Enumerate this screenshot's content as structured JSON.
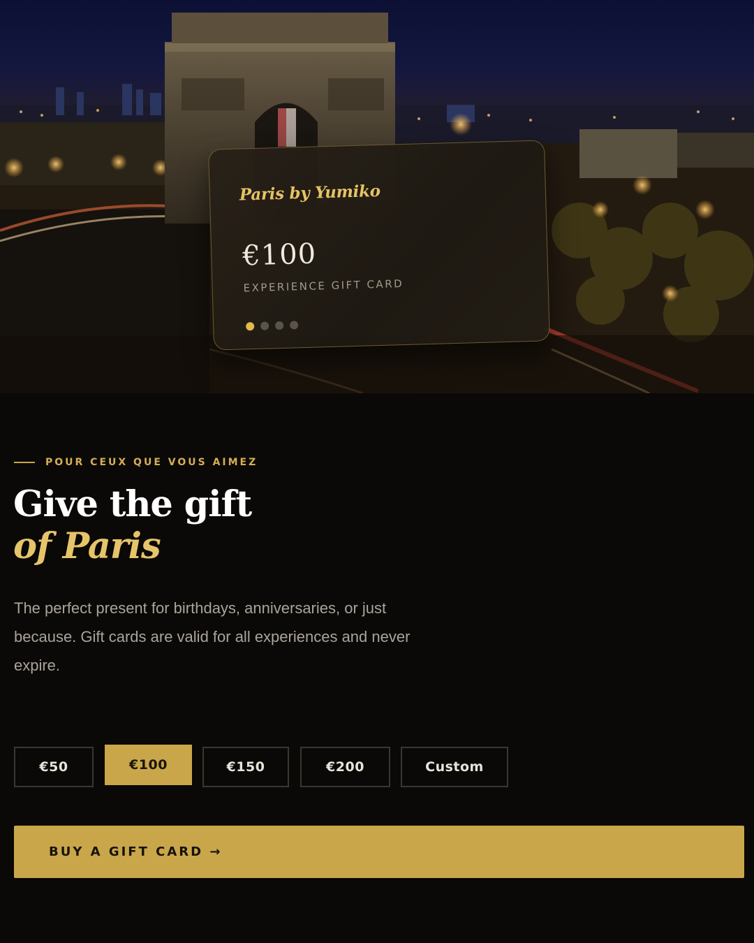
{
  "hero": {
    "card": {
      "brand": "Paris by Yumiko",
      "value": "€100",
      "type": "EXPERIENCE GIFT CARD",
      "carousel": {
        "total": 4,
        "active": 1
      }
    }
  },
  "section": {
    "eyebrow": "POUR CEUX QUE VOUS AIMEZ",
    "headline_line1": "Give the gift",
    "headline_line2": "of Paris",
    "description": "The perfect present for birthdays, anniversaries, or just because. Gift cards are valid for all experiences and never expire."
  },
  "amounts": {
    "options": [
      "€50",
      "€100",
      "€150",
      "€200",
      "Custom"
    ],
    "selected": "€100"
  },
  "cta": {
    "label": "BUY A GIFT CARD →"
  },
  "colors": {
    "accent": "#c9a64a",
    "background": "#0b0907"
  }
}
